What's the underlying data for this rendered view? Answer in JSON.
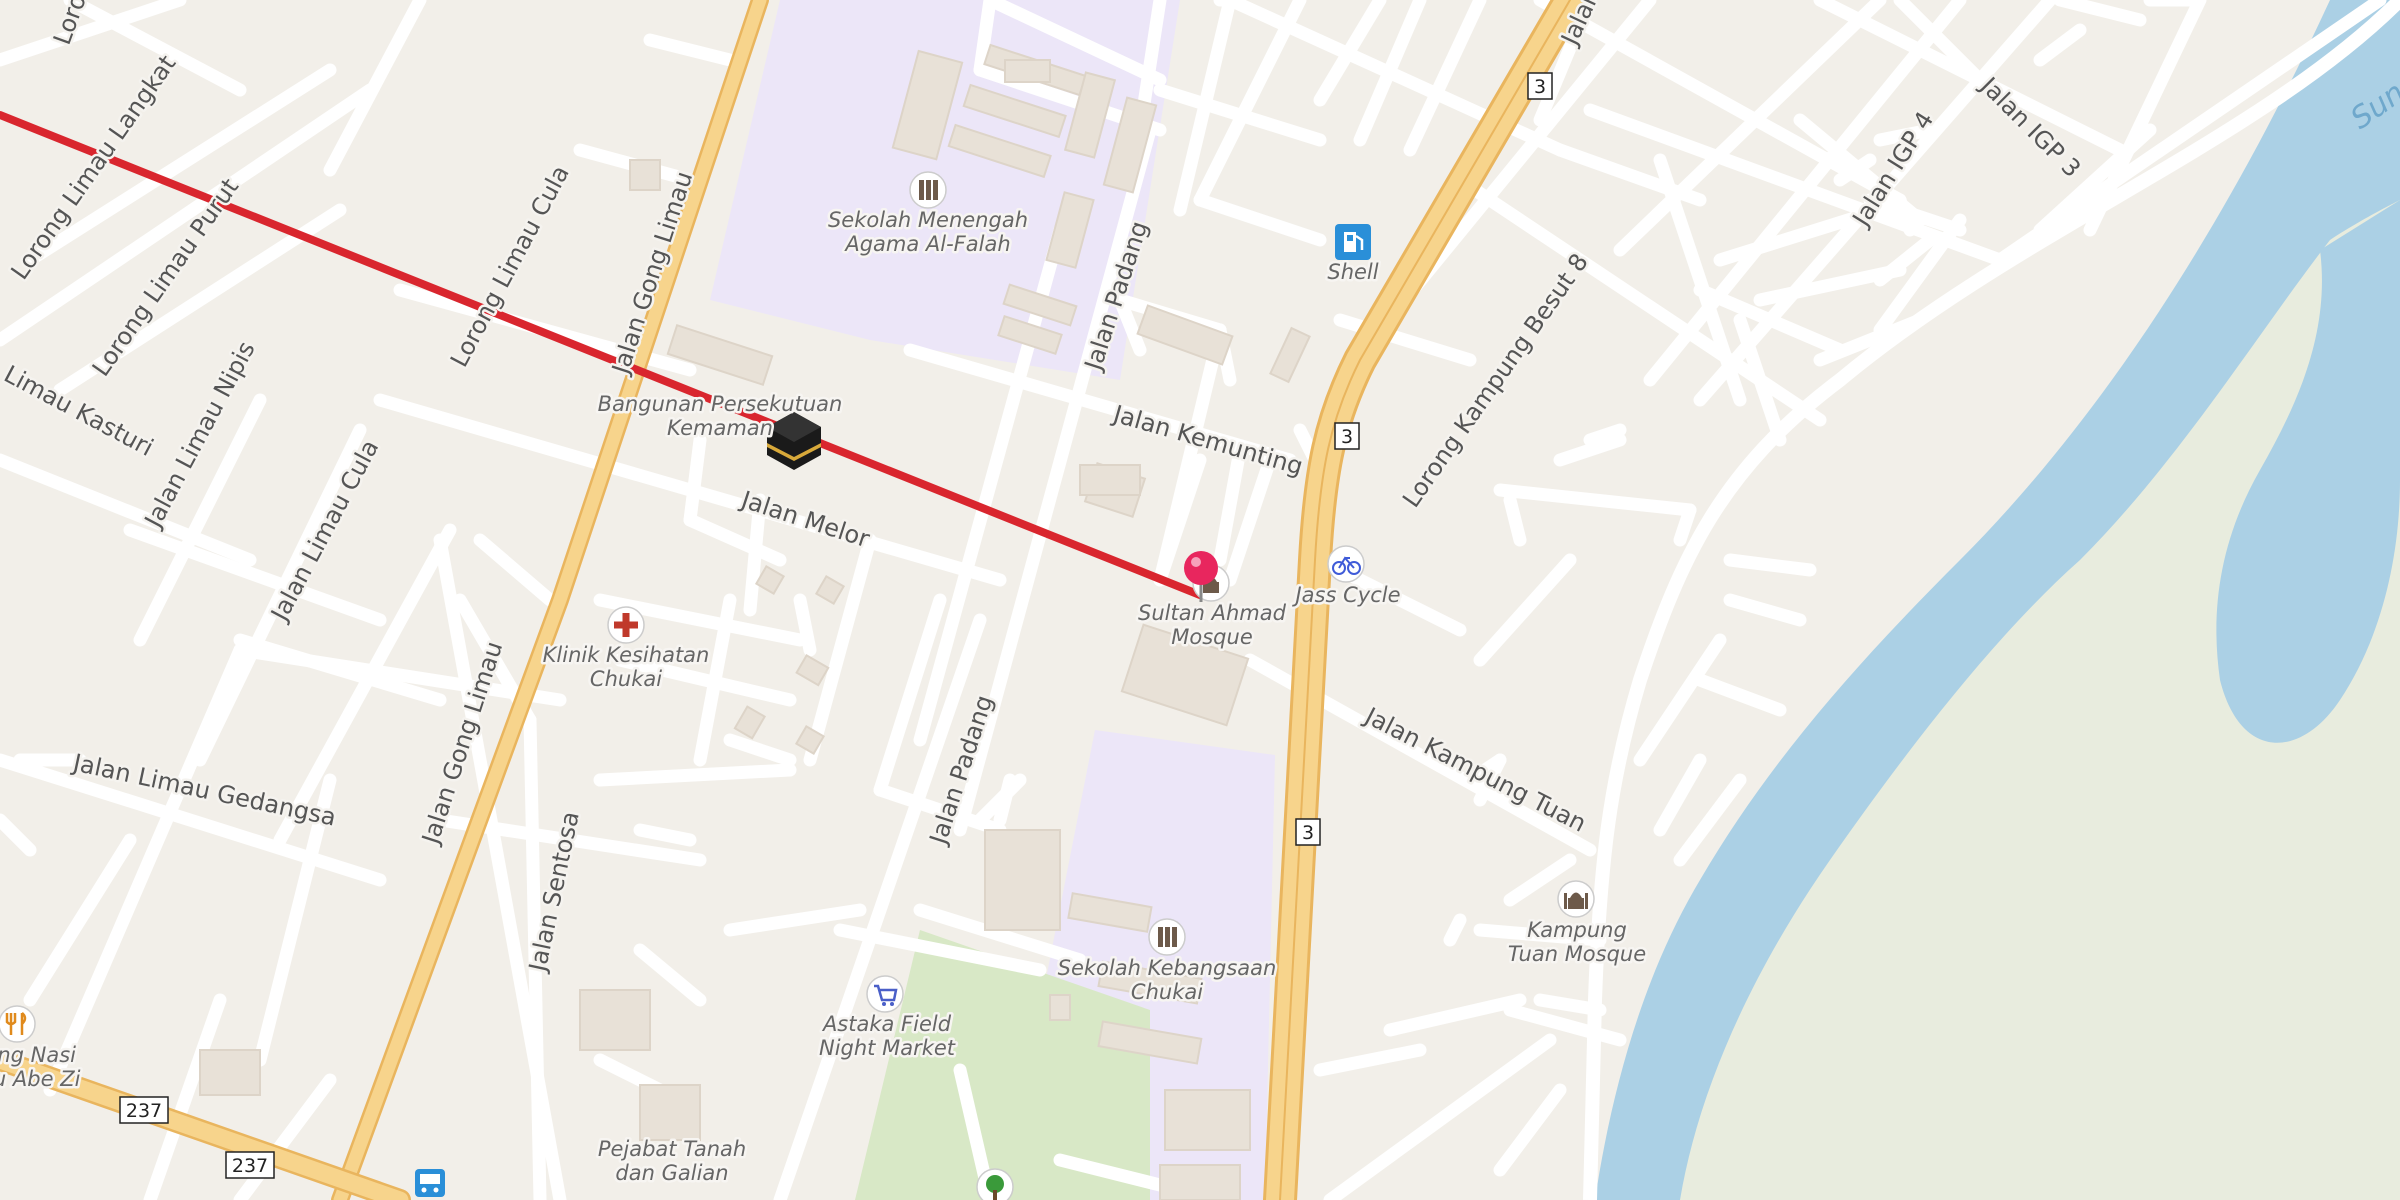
{
  "map": {
    "pois": {
      "school_alfalah": "Sekolah Menengah Agama Al-Falah",
      "shell": "Shell",
      "bangunan": "Bangunan Persekutuan Kemaman",
      "mosque": "Sultan Ahmad Mosque",
      "jass_cycle": "Jass Cycle",
      "klinik": "Klinik Kesihatan Chukai",
      "school_chukai": "Sekolah Kebangsaan Chukai",
      "astaka": "Astaka Field Night Market",
      "kampung_mosque": "Kampung Tuan Mosque",
      "pejabat": "Pejabat Tanah dan Galian",
      "restaurant": "ung Nasi pu Abe Zi"
    },
    "streets": {
      "lorong_limau_langkat": "Lorong Limau Langkat",
      "lorong_limau_purut": "Lorong Limau Purut",
      "lorong_limau_cula": "Lorong Limau Cula",
      "jalan_limau_nipis": "Jalan Limau Nipis",
      "limau_kasturi": "Limau Kasturi",
      "jalan_limau_cula": "Jalan Limau Cula",
      "jalan_gong_limau": "Jalan Gong Limau",
      "jalan_melor": "Jalan Melor",
      "jalan_padang": "Jalan Padang",
      "jalan_kemunting": "Jalan Kemunting",
      "jalan_limau_gedangsa": "Jalan Limau Gedangsa",
      "jalan_sentosa": "Jalan Sentosa",
      "jalan_kampung_tuan": "Jalan Kampung Tuan",
      "lorong_kampung_besut_8": "Lorong Kampung Besut 8",
      "jalan_igp_4": "Jalan IGP 4",
      "jalan_igp_3": "Jalan IGP 3",
      "jalan_top": "Jalan",
      "lorong_top": "Loron",
      "sungai": "Sun"
    },
    "shields": {
      "route3": "3",
      "route237": "237"
    },
    "icons": [
      "kaaba-icon",
      "map-pin-icon",
      "school-icon",
      "fuel-icon",
      "bicycle-icon",
      "hospital-icon",
      "shopping-cart-icon",
      "mosque-icon",
      "restaurant-icon",
      "bus-stop-icon",
      "tree-icon"
    ],
    "colors": {
      "background": "#f2efe9",
      "qibla_line": "#d9262e",
      "pin": "#e8265e",
      "highway": "#f7c970",
      "school_area": "#ece6f8",
      "park": "#d8e8c6",
      "water": "#abd0e5",
      "vegetation": "#e8ecde"
    }
  }
}
